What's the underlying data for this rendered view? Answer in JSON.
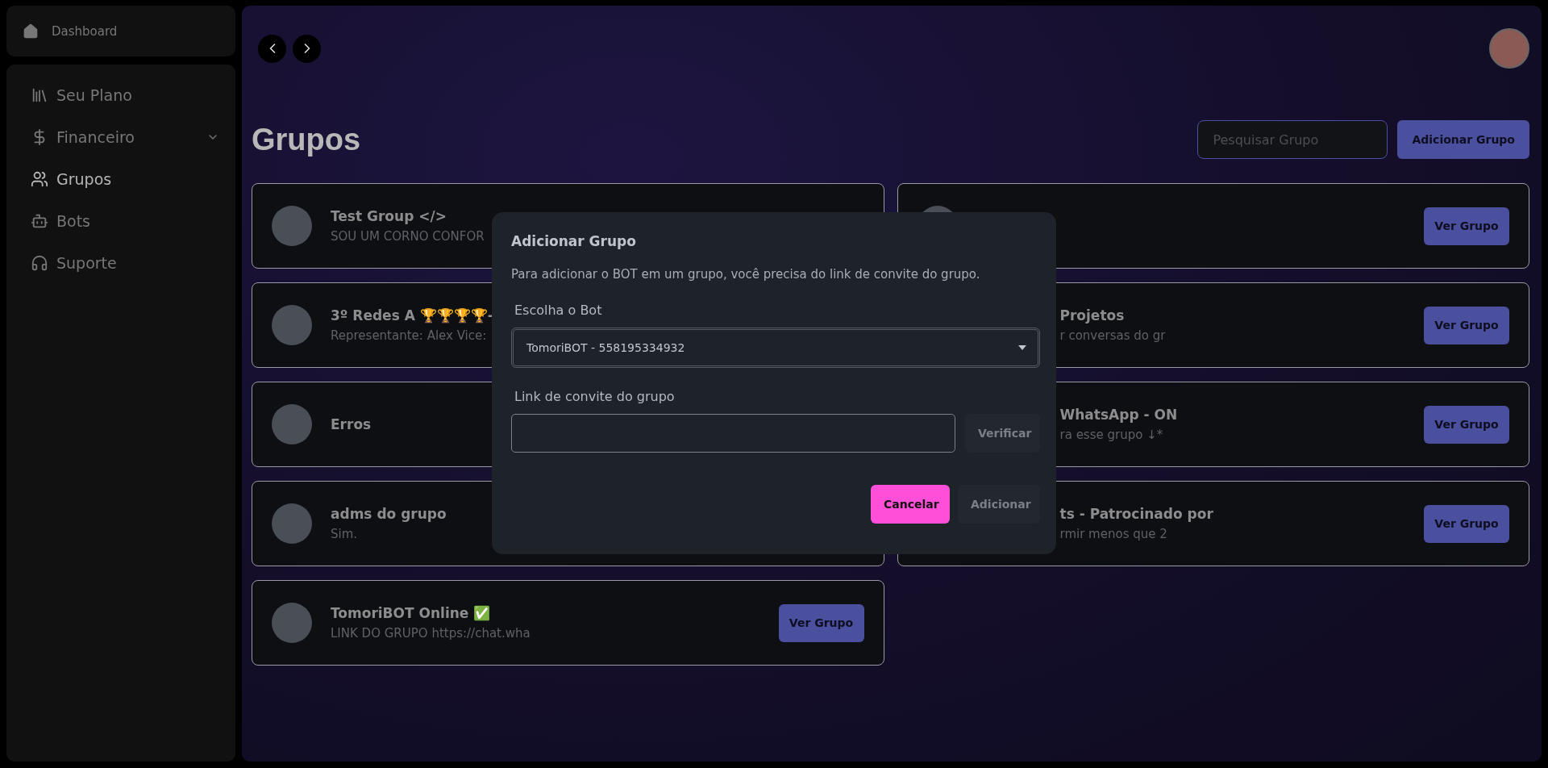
{
  "sidebar": {
    "top_item": {
      "label": "Dashboard"
    },
    "items": [
      {
        "label": "Seu Plano",
        "selected": false,
        "has_submenu": false
      },
      {
        "label": "Financeiro",
        "selected": false,
        "has_submenu": true
      },
      {
        "label": "Grupos",
        "selected": true,
        "has_submenu": false
      },
      {
        "label": "Bots",
        "selected": false,
        "has_submenu": false
      },
      {
        "label": "Suporte",
        "selected": false,
        "has_submenu": false
      }
    ]
  },
  "page": {
    "title": "Grupos",
    "search": {
      "placeholder": "Pesquisar Grupo"
    },
    "add_button": "Adicionar Grupo"
  },
  "groups": [
    {
      "title": "Test Group </>",
      "subtitle": "SOU UM CORNO CONFOR"
    },
    {
      "button": "Ver Grupo"
    },
    {
      "title": "3º Redes A 🏆🏆🏆🏆-",
      "subtitle": "Representante: Alex Vice:"
    },
    {
      "title": "Projetos",
      "subtitle": "r conversas do gr",
      "button": "Ver Grupo"
    },
    {
      "title": "Erros"
    },
    {
      "title": "WhatsApp - ON",
      "subtitle": "ra esse grupo ↓*",
      "button": "Ver Grupo"
    },
    {
      "title": "adms do grupo",
      "subtitle": "Sim."
    },
    {
      "title": "ts - Patrocinado por",
      "subtitle": "rmir menos que 2",
      "button": "Ver Grupo"
    },
    {
      "title": "TomoriBOT Online ✅",
      "subtitle": "LINK DO GRUPO https://chat.wha",
      "button": "Ver Grupo"
    }
  ],
  "modal": {
    "title": "Adicionar Grupo",
    "description": "Para adicionar o BOT em um grupo, você precisa do link de convite do grupo.",
    "bot_label": "Escolha o Bot",
    "bot_value": "TomoriBOT - 558195334932",
    "link_label": "Link de convite do grupo",
    "verify_button": {
      "label": "Verificar",
      "disabled": true
    },
    "cancel_button": "Cancelar",
    "add_button": {
      "label": "Adicionar",
      "disabled": true
    }
  }
}
